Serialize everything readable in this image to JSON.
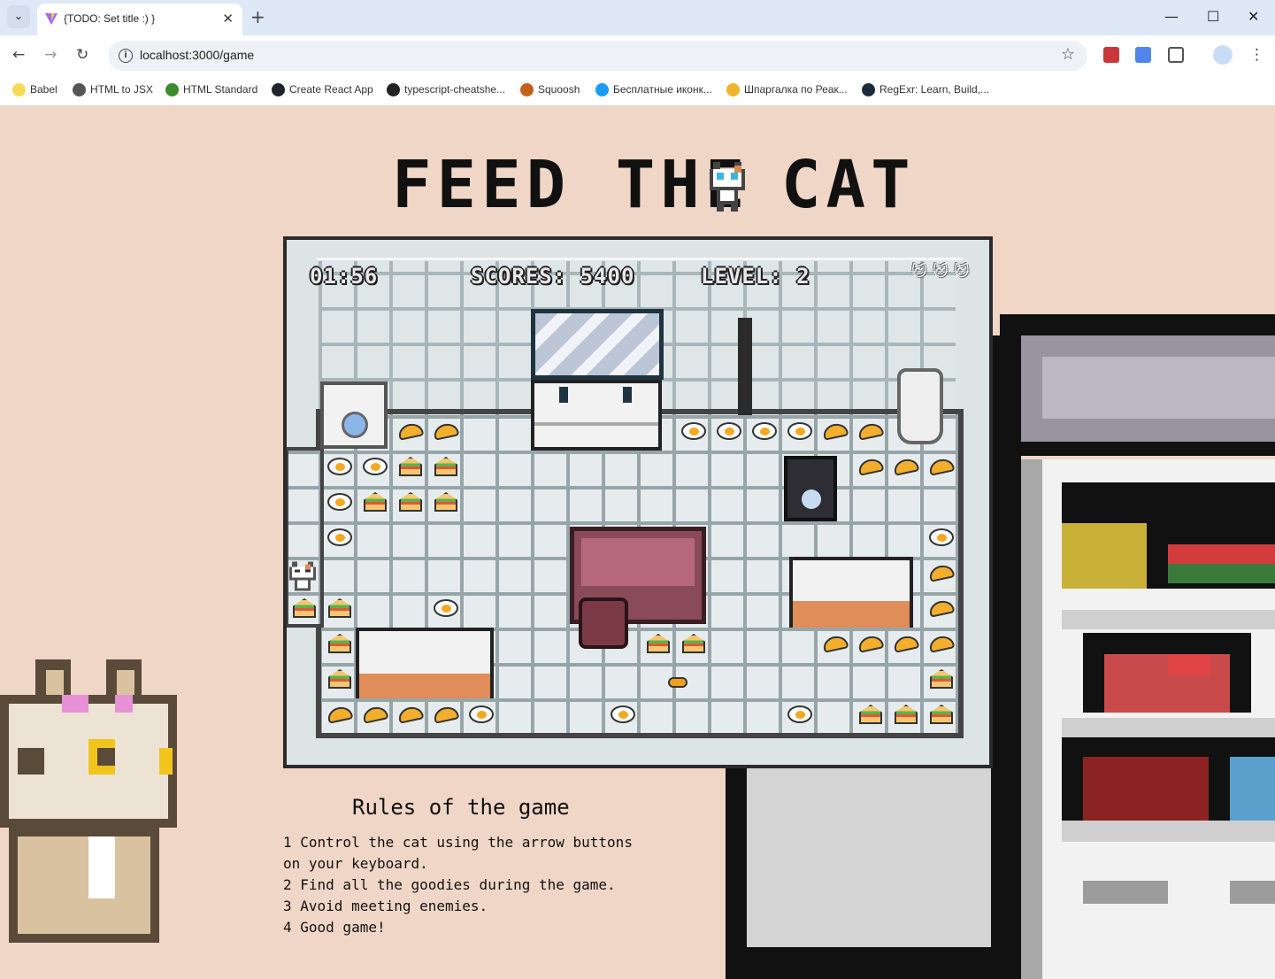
{
  "browser": {
    "tab_title": "{TODO: Set title :) }",
    "url": "localhost:3000/game",
    "bookmarks": [
      {
        "label": "Babel",
        "color": "#f5da55"
      },
      {
        "label": "HTML to JSX",
        "color": "#555555"
      },
      {
        "label": "HTML Standard",
        "color": "#3c8c2c"
      },
      {
        "label": "Create React App",
        "color": "#20232a"
      },
      {
        "label": "typescript-cheatshe...",
        "color": "#222222"
      },
      {
        "label": "Squoosh",
        "color": "#c2601c"
      },
      {
        "label": "Бесплатные иконк...",
        "color": "#1a9bf5"
      },
      {
        "label": "Шпаргалка по Реак...",
        "color": "#f0b429"
      },
      {
        "label": "RegExr: Learn, Build,...",
        "color": "#1c2b3a"
      }
    ]
  },
  "page": {
    "title_left": "FEED THE",
    "title_right": "CAT",
    "title_icon": "cat-icon"
  },
  "hud": {
    "timer": "01:56",
    "scores": "SCORES: 5400",
    "level": "LEVEL: 2",
    "lives": 3
  },
  "board": {
    "foods": [
      {
        "type": "omelet",
        "col": 3,
        "row": 0
      },
      {
        "type": "omelet",
        "col": 4,
        "row": 0
      },
      {
        "type": "egg",
        "col": 11,
        "row": 0
      },
      {
        "type": "egg",
        "col": 12,
        "row": 0
      },
      {
        "type": "egg",
        "col": 13,
        "row": 0
      },
      {
        "type": "egg",
        "col": 14,
        "row": 0
      },
      {
        "type": "omelet",
        "col": 15,
        "row": 0
      },
      {
        "type": "omelet",
        "col": 16,
        "row": 0
      },
      {
        "type": "egg",
        "col": 1,
        "row": 1
      },
      {
        "type": "egg",
        "col": 2,
        "row": 1
      },
      {
        "type": "sandwich",
        "col": 3,
        "row": 1
      },
      {
        "type": "sandwich",
        "col": 4,
        "row": 1
      },
      {
        "type": "omelet",
        "col": 16,
        "row": 1
      },
      {
        "type": "omelet",
        "col": 17,
        "row": 1
      },
      {
        "type": "omelet",
        "col": 18,
        "row": 1
      },
      {
        "type": "egg",
        "col": 1,
        "row": 2
      },
      {
        "type": "sandwich",
        "col": 2,
        "row": 2
      },
      {
        "type": "sandwich",
        "col": 3,
        "row": 2
      },
      {
        "type": "sandwich",
        "col": 4,
        "row": 2
      },
      {
        "type": "egg",
        "col": 1,
        "row": 3
      },
      {
        "type": "egg",
        "col": 18,
        "row": 3
      },
      {
        "type": "omelet",
        "col": 18,
        "row": 4
      },
      {
        "type": "sandwich",
        "col": 0,
        "row": 5
      },
      {
        "type": "sandwich",
        "col": 1,
        "row": 5
      },
      {
        "type": "egg",
        "col": 4,
        "row": 5
      },
      {
        "type": "omelet",
        "col": 18,
        "row": 5
      },
      {
        "type": "sandwich",
        "col": 1,
        "row": 6
      },
      {
        "type": "sandwich",
        "col": 10,
        "row": 6
      },
      {
        "type": "sandwich",
        "col": 11,
        "row": 6
      },
      {
        "type": "omelet",
        "col": 15,
        "row": 6
      },
      {
        "type": "omelet",
        "col": 16,
        "row": 6
      },
      {
        "type": "omelet",
        "col": 17,
        "row": 6
      },
      {
        "type": "omelet",
        "col": 18,
        "row": 6
      },
      {
        "type": "sandwich",
        "col": 1,
        "row": 7
      },
      {
        "type": "sandwich",
        "col": 18,
        "row": 7
      },
      {
        "type": "omelet",
        "col": 1,
        "row": 8
      },
      {
        "type": "omelet",
        "col": 2,
        "row": 8
      },
      {
        "type": "omelet",
        "col": 3,
        "row": 8
      },
      {
        "type": "omelet",
        "col": 4,
        "row": 8
      },
      {
        "type": "egg",
        "col": 5,
        "row": 8
      },
      {
        "type": "egg",
        "col": 9,
        "row": 8
      },
      {
        "type": "egg",
        "col": 14,
        "row": 8
      },
      {
        "type": "sandwich",
        "col": 16,
        "row": 8
      },
      {
        "type": "sandwich",
        "col": 17,
        "row": 8
      },
      {
        "type": "sandwich",
        "col": 18,
        "row": 8
      }
    ],
    "player": "cat-player-icon",
    "enemy": "cockroach-icon",
    "furniture": [
      "window-icon",
      "sink-counter-icon",
      "washing-machine-icon",
      "coat-rack-icon",
      "toilet-icon",
      "stove-icon",
      "table-icon",
      "chair-icon",
      "kitchen-sink-icon",
      "bathtub-icon"
    ]
  },
  "rules": {
    "title": "Rules of the game",
    "lines": [
      "1 Control the cat using the arrow buttons",
      "on your keyboard.",
      "2 Find all the goodies during the game.",
      "3 Avoid meeting enemies.",
      "4 Good game!"
    ]
  },
  "colors": {
    "background": "#f0d6c6",
    "board": "#dde4e5",
    "accent_red": "#c9373a"
  }
}
